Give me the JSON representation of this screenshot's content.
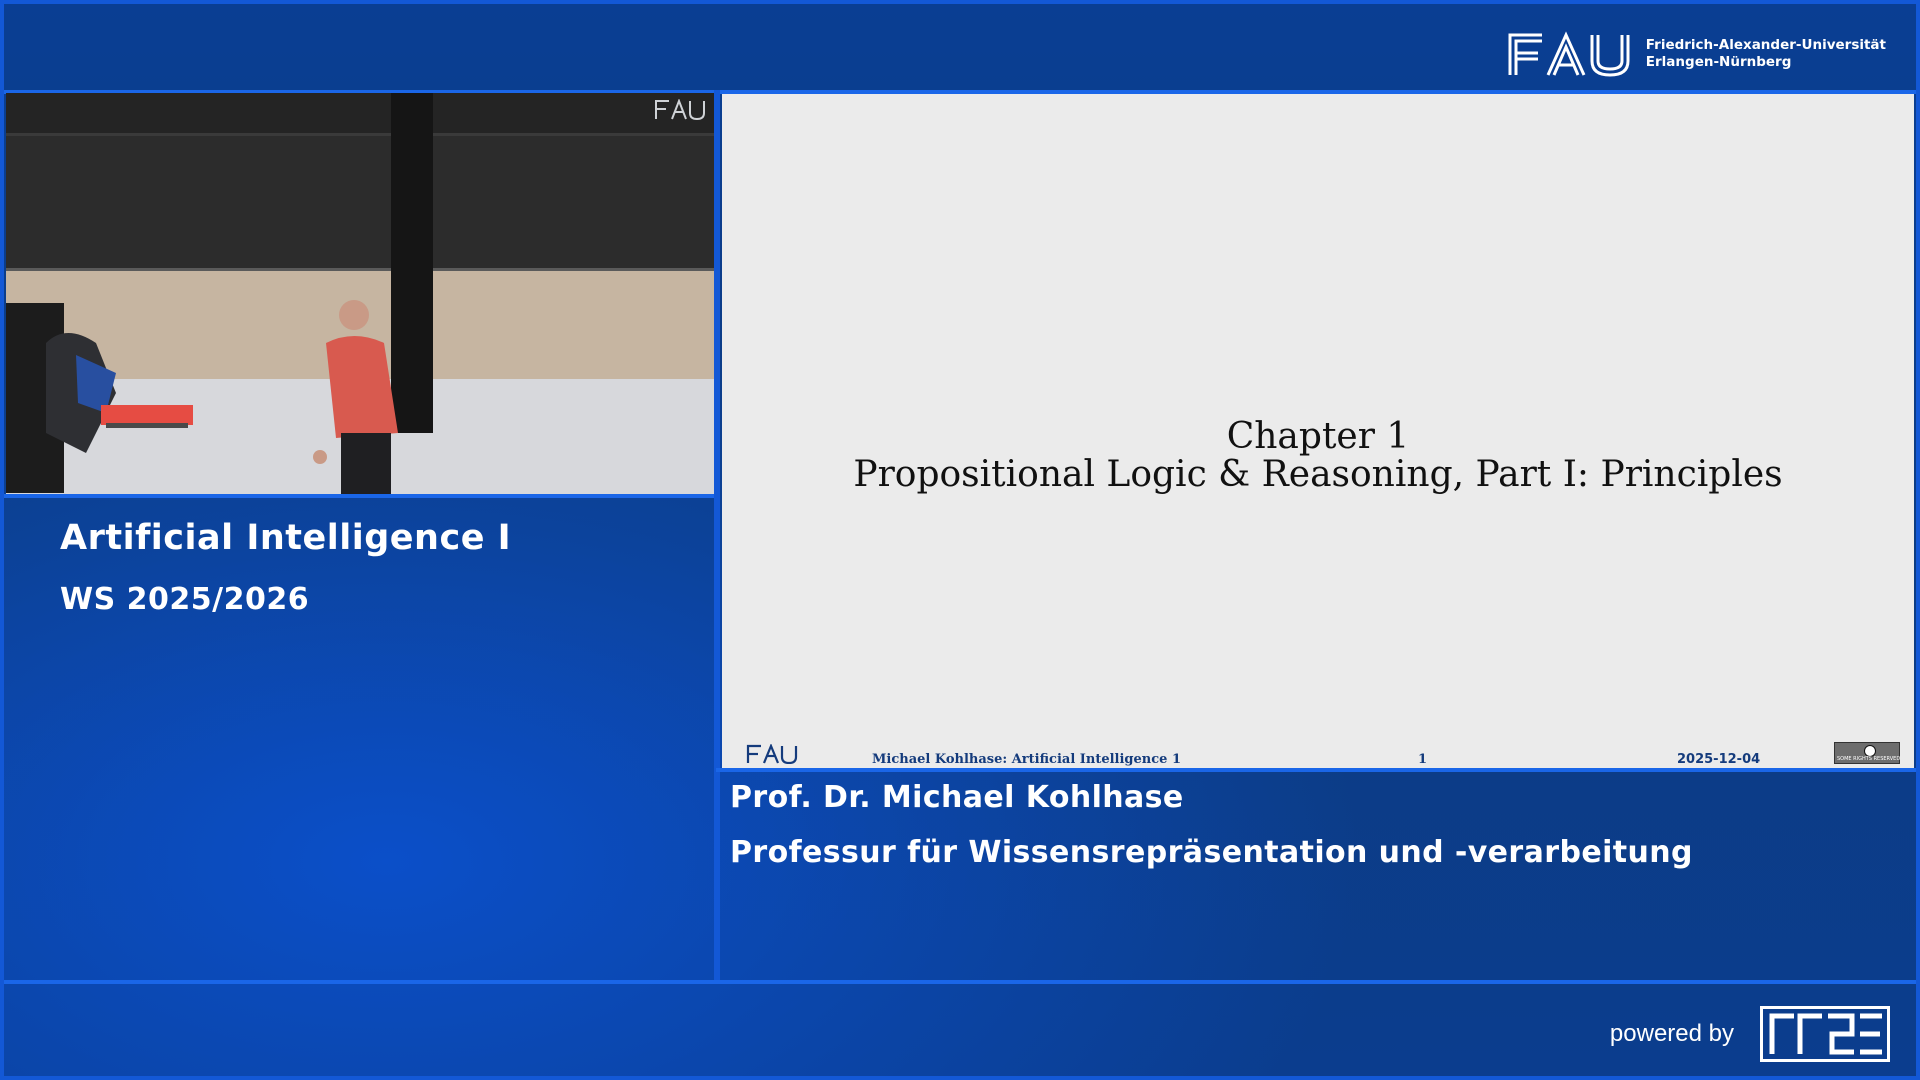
{
  "header": {
    "logo_text": "FAU",
    "university_line1": "Friedrich-Alexander-Universität",
    "university_line2": "Erlangen-Nürnberg"
  },
  "camera": {
    "watermark": "FAU"
  },
  "course": {
    "title": "Artificial Intelligence I",
    "term": "WS 2025/2026"
  },
  "slide": {
    "title_line1": "Chapter 1",
    "title_line2": "Propositional Logic & Reasoning, Part I: Principles",
    "footer": {
      "logo": "FAU",
      "author": "Michael Kohlhase:  Artificial Intelligence 1",
      "page": "1",
      "date": "2025-12-04",
      "license_text": "SOME RIGHTS RESERVED"
    }
  },
  "speaker": {
    "name": "Prof. Dr. Michael Kohlhase",
    "chair": "Professur für Wissensrepräsentation und -verarbeitung"
  },
  "footer": {
    "powered_by": "powered by",
    "logo_icon": "rrze-logo-icon"
  },
  "colors": {
    "background": "#0a3a86",
    "accent_border": "#1358d6",
    "slide_bg": "#ebebeb",
    "slide_footer_text": "#143b7c"
  }
}
